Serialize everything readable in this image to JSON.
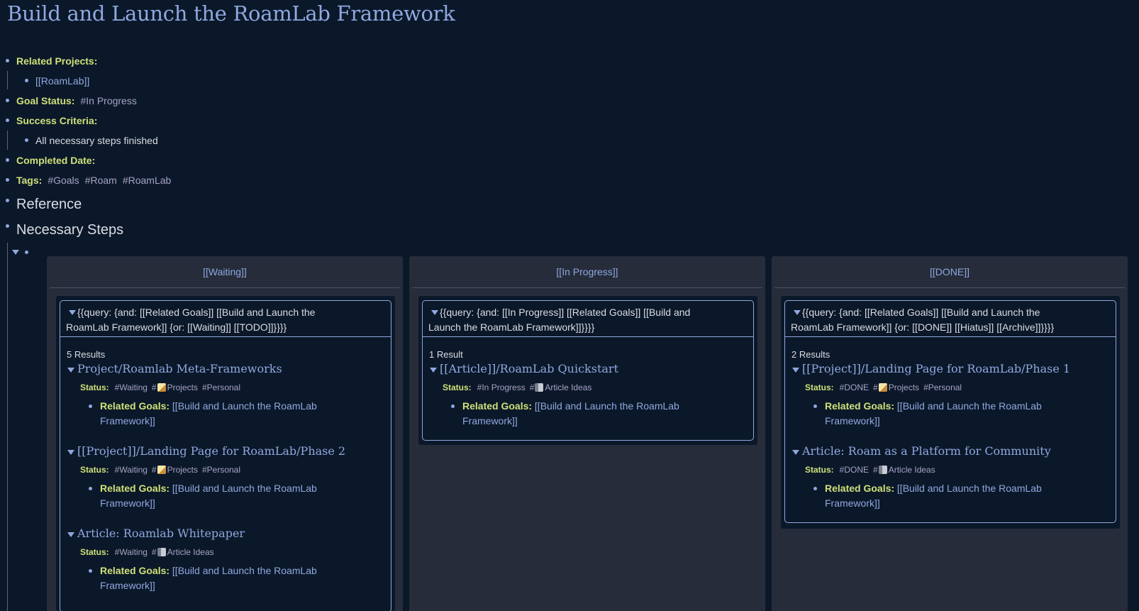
{
  "page": {
    "title": "Build and Launch the RoamLab Framework"
  },
  "attributes": {
    "related_projects_label": "Related Projects:",
    "related_projects_value": "[[RoamLab]]",
    "goal_status_label": "Goal Status:",
    "goal_status_value": "#In Progress",
    "success_criteria_label": "Success Criteria:",
    "success_criteria_value": "All necessary steps finished",
    "completed_date_label": "Completed Date:",
    "tags_label": "Tags:",
    "tags": [
      "#Goals",
      "#Roam",
      "#RoamLab"
    ]
  },
  "sections": {
    "reference": "Reference",
    "necessary_steps": "Necessary Steps"
  },
  "columns": [
    {
      "header": "[[Waiting]]",
      "query_line1": "{{query:  {and: [[Related Goals]] [[Build and Launch the",
      "query_line2": "RoamLab Framework]] {or: [[Waiting]] [[TODO]]}}}}",
      "count": "5 Results",
      "results": [
        {
          "title": "Project/Roamlab Meta-Frameworks",
          "status_label": "Status:",
          "status": "#Waiting",
          "category": "Projects",
          "category_icon": "memo-icon",
          "extra": "#Personal",
          "goal_label": "Related Goals:",
          "goal_line1": "[[Build and Launch the RoamLab",
          "goal_line2": "Framework]]"
        },
        {
          "title": "[[Project]]/Landing Page for RoamLab/Phase 2",
          "status_label": "Status:",
          "status": "#Waiting",
          "category": "Projects",
          "category_icon": "memo-icon",
          "extra": "#Personal",
          "goal_label": "Related Goals:",
          "goal_line1": "[[Build and Launch the RoamLab",
          "goal_line2": "Framework]]"
        },
        {
          "title": "Article: Roamlab Whitepaper",
          "status_label": "Status:",
          "status": "#Waiting",
          "category": "Article Ideas",
          "category_icon": "notebook-icon",
          "extra": "",
          "goal_label": "Related Goals:",
          "goal_line1": "[[Build and Launch the RoamLab",
          "goal_line2": "Framework]]"
        }
      ]
    },
    {
      "header": "[[In Progress]]",
      "query_line1": "{{query:  {and: [[In Progress]] [[Related Goals]] [[Build and",
      "query_line2": "Launch the RoamLab Framework]]}}}}",
      "count": "1 Result",
      "results": [
        {
          "title": "[[Article]]/RoamLab Quickstart",
          "status_label": "Status:",
          "status": "#In Progress",
          "category": "Article Ideas",
          "category_icon": "notebook-icon",
          "extra": "",
          "goal_label": "Related Goals:",
          "goal_line1": "[[Build and Launch the RoamLab",
          "goal_line2": "Framework]]"
        }
      ]
    },
    {
      "header": "[[DONE]]",
      "query_line1": "{{query:  {and: [[Related Goals]] [[Build and Launch the",
      "query_line2": "RoamLab Framework]] {or: [[DONE]] [[Hiatus]] [[Archive]]}}}}",
      "count": "2 Results",
      "results": [
        {
          "title": "[[Project]]/Landing Page for RoamLab/Phase 1",
          "status_label": "Status:",
          "status": "#DONE",
          "category": "Projects",
          "category_icon": "memo-icon",
          "extra": "#Personal",
          "goal_label": "Related Goals:",
          "goal_line1": "[[Build and Launch the RoamLab",
          "goal_line2": "Framework]]"
        },
        {
          "title": "Article: Roam as a Platform for Community",
          "status_label": "Status:",
          "status": "#DONE",
          "category": "Article Ideas",
          "category_icon": "notebook-icon",
          "extra": "",
          "goal_label": "Related Goals:",
          "goal_line1": "[[Build and Launch the RoamLab",
          "goal_line2": "Framework]]"
        }
      ]
    }
  ]
}
